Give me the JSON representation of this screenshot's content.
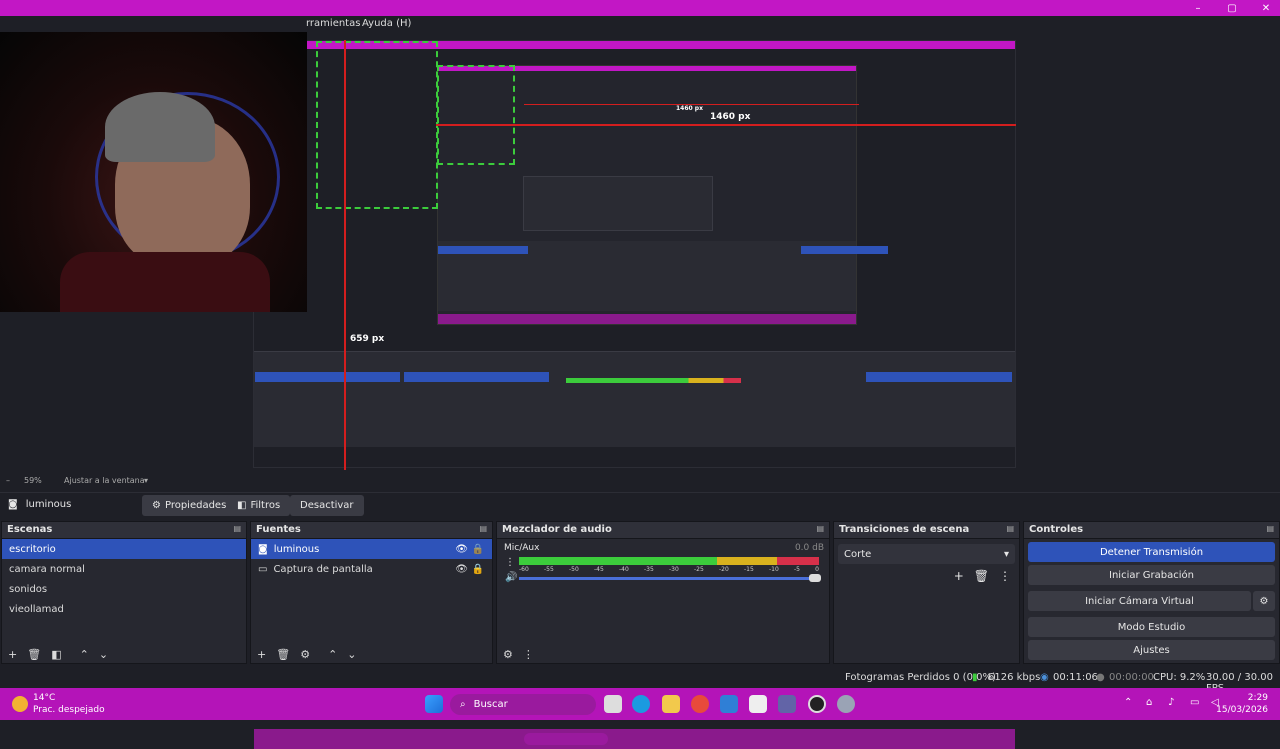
{
  "window": {
    "minimize": "–",
    "maximize": "▢",
    "close": "✕"
  },
  "menu": {
    "tools": "rramientas",
    "help": "Ayuda (H)"
  },
  "preview": {
    "measure_h": "1460 px",
    "measure_h_small": "1460 px",
    "measure_v": "659 px"
  },
  "zoom": {
    "minus": "–",
    "value": "59%",
    "fit": "Ajustar a la ventana"
  },
  "source_toolbar": {
    "source_name": "luminous",
    "properties": "Propiedades",
    "filters": "Filtros",
    "deactivate": "Desactivar"
  },
  "scenes": {
    "title": "Escenas",
    "items": [
      "escritorio",
      "camara normal",
      "sonidos",
      "vieollamad"
    ]
  },
  "sources": {
    "title": "Fuentes",
    "items": [
      "luminous",
      "Captura de pantalla"
    ]
  },
  "mixer": {
    "title": "Mezclador de audio",
    "channel": "Mic/Aux",
    "db": "0.0 dB",
    "ticks": [
      "-60",
      "-55",
      "-50",
      "-45",
      "-40",
      "-35",
      "-30",
      "-25",
      "-20",
      "-15",
      "-10",
      "-5",
      "0"
    ]
  },
  "transitions": {
    "title": "Transiciones de escena",
    "selected": "Corte"
  },
  "controls": {
    "title": "Controles",
    "stop_stream": "Detener Transmisión",
    "start_rec": "Iniciar Grabación",
    "virtual_cam": "Iniciar Cámara Virtual",
    "studio": "Modo Estudio",
    "settings": "Ajustes"
  },
  "status": {
    "dropped": "Fotogramas Perdidos 0 (0.0%)",
    "bitrate": "6126 kbps",
    "stream_time": "00:11:06",
    "rec_time": "00:00:00",
    "cpu": "CPU: 9.2%",
    "fps": "30.00 / 30.00 FPS"
  },
  "taskbar": {
    "temp": "14°C",
    "weather": "Prac. despejado",
    "search": "Buscar",
    "time": "2:29",
    "date": "15/03/2026"
  },
  "colors": {
    "accent": "#2e53b9",
    "magenta": "#c217c5",
    "meter_green": "#3ccc3c",
    "meter_yellow": "#d9b21e",
    "meter_red": "#d6304a"
  }
}
